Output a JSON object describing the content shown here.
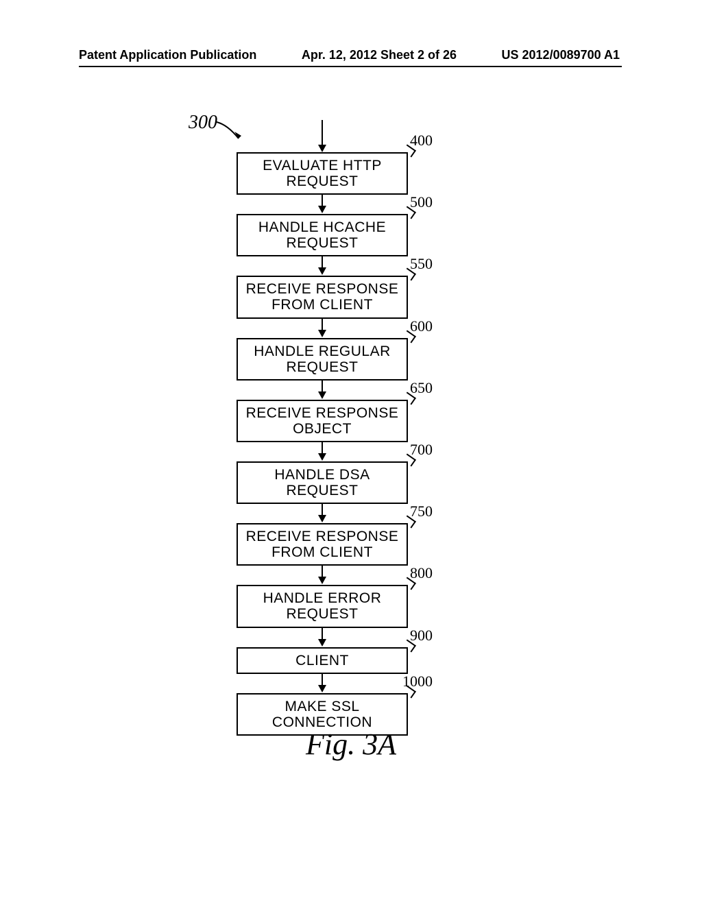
{
  "header": {
    "left": "Patent Application Publication",
    "center": "Apr. 12, 2012  Sheet 2 of 26",
    "right": "US 2012/0089700 A1"
  },
  "pointer_label": "300",
  "steps": [
    {
      "ref": "400",
      "text1": "EVALUATE HTTP REQUEST",
      "text2": ""
    },
    {
      "ref": "500",
      "text1": "HANDLE HCACHE REQUEST",
      "text2": ""
    },
    {
      "ref": "550",
      "text1": "RECEIVE RESPONSE",
      "text2": "FROM CLIENT"
    },
    {
      "ref": "600",
      "text1": "HANDLE REGULAR REQUEST",
      "text2": ""
    },
    {
      "ref": "650",
      "text1": "RECEIVE RESPONSE OBJECT",
      "text2": ""
    },
    {
      "ref": "700",
      "text1": "HANDLE DSA REQUEST",
      "text2": ""
    },
    {
      "ref": "750",
      "text1": "RECEIVE RESPONSE",
      "text2": "FROM CLIENT"
    },
    {
      "ref": "800",
      "text1": "HANDLE ERROR REQUEST",
      "text2": ""
    },
    {
      "ref": "900",
      "text1": "CLIENT",
      "text2": ""
    },
    {
      "ref": "1000",
      "text1": "MAKE SSL CONNECTION",
      "text2": ""
    }
  ],
  "figure_caption": "Fig. 3A"
}
